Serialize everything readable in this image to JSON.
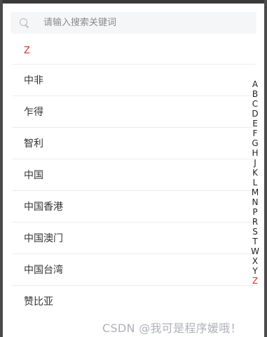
{
  "search": {
    "placeholder": "请输入搜索关键词",
    "value": ""
  },
  "section": {
    "letter": "Z"
  },
  "countries": [
    "中非",
    "乍得",
    "智利",
    "中国",
    "中国香港",
    "中国澳门",
    "中国台湾",
    "赞比亚"
  ],
  "index_letters": [
    "A",
    "B",
    "C",
    "D",
    "E",
    "F",
    "G",
    "H",
    "J",
    "K",
    "L",
    "M",
    "N",
    "P",
    "R",
    "S",
    "T",
    "W",
    "X",
    "Y",
    "Z"
  ],
  "index_active": "Z",
  "watermark": "CSDN @我可是程序媛哦！",
  "colors": {
    "accent": "#e02e24",
    "search_bg": "#f5f6f8",
    "divider": "#ececec"
  }
}
